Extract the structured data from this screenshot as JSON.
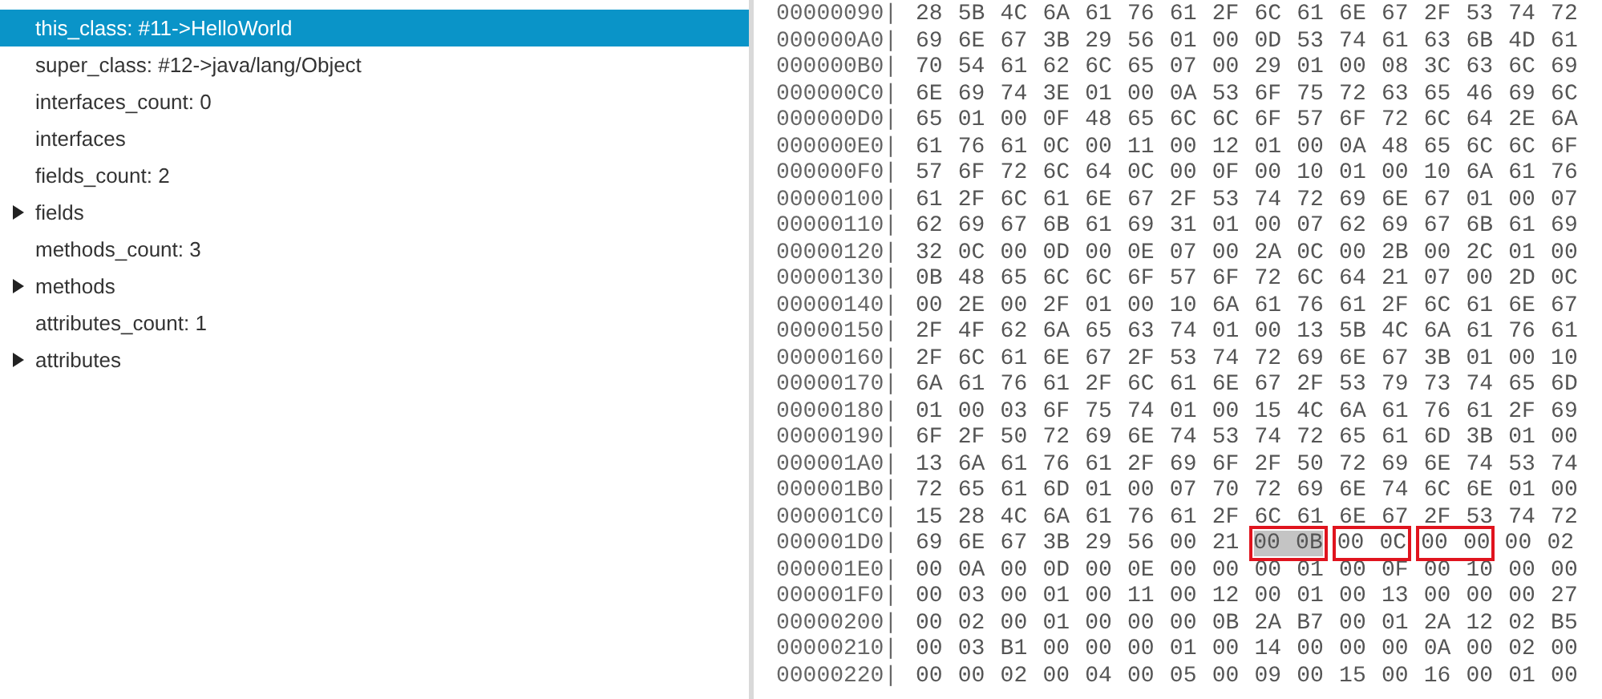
{
  "tree": {
    "items": [
      {
        "label": "this_class: #11->HelloWorld",
        "kind": "leaf",
        "selected": true
      },
      {
        "label": "super_class: #12->java/lang/Object",
        "kind": "leaf",
        "selected": false
      },
      {
        "label": "interfaces_count: 0",
        "kind": "leaf",
        "selected": false
      },
      {
        "label": "interfaces",
        "kind": "leaf",
        "selected": false
      },
      {
        "label": "fields_count: 2",
        "kind": "leaf",
        "selected": false
      },
      {
        "label": "fields",
        "kind": "node",
        "expanded": false,
        "selected": false
      },
      {
        "label": "methods_count: 3",
        "kind": "leaf",
        "selected": false
      },
      {
        "label": "methods",
        "kind": "node",
        "expanded": false,
        "selected": false
      },
      {
        "label": "attributes_count: 1",
        "kind": "leaf",
        "selected": false
      },
      {
        "label": "attributes",
        "kind": "node",
        "expanded": false,
        "selected": false
      }
    ]
  },
  "hex": {
    "rows": [
      {
        "offset": "00000090|",
        "segments": [
          {
            "text": "28 5B 4C 6A 61 76 61 2F 6C 61 6E 67 2F 53 74 72",
            "boxed": false,
            "selected": false
          }
        ]
      },
      {
        "offset": "000000A0|",
        "segments": [
          {
            "text": "69 6E 67 3B 29 56 01 00 0D 53 74 61 63 6B 4D 61",
            "boxed": false,
            "selected": false
          }
        ]
      },
      {
        "offset": "000000B0|",
        "segments": [
          {
            "text": "70 54 61 62 6C 65 07 00 29 01 00 08 3C 63 6C 69",
            "boxed": false,
            "selected": false
          }
        ]
      },
      {
        "offset": "000000C0|",
        "segments": [
          {
            "text": "6E 69 74 3E 01 00 0A 53 6F 75 72 63 65 46 69 6C",
            "boxed": false,
            "selected": false
          }
        ]
      },
      {
        "offset": "000000D0|",
        "segments": [
          {
            "text": "65 01 00 0F 48 65 6C 6C 6F 57 6F 72 6C 64 2E 6A",
            "boxed": false,
            "selected": false
          }
        ]
      },
      {
        "offset": "000000E0|",
        "segments": [
          {
            "text": "61 76 61 0C 00 11 00 12 01 00 0A 48 65 6C 6C 6F",
            "boxed": false,
            "selected": false
          }
        ]
      },
      {
        "offset": "000000F0|",
        "segments": [
          {
            "text": "57 6F 72 6C 64 0C 00 0F 00 10 01 00 10 6A 61 76",
            "boxed": false,
            "selected": false
          }
        ]
      },
      {
        "offset": "00000100|",
        "segments": [
          {
            "text": "61 2F 6C 61 6E 67 2F 53 74 72 69 6E 67 01 00 07",
            "boxed": false,
            "selected": false
          }
        ]
      },
      {
        "offset": "00000110|",
        "segments": [
          {
            "text": "62 69 67 6B 61 69 31 01 00 07 62 69 67 6B 61 69",
            "boxed": false,
            "selected": false
          }
        ]
      },
      {
        "offset": "00000120|",
        "segments": [
          {
            "text": "32 0C 00 0D 00 0E 07 00 2A 0C 00 2B 00 2C 01 00",
            "boxed": false,
            "selected": false
          }
        ]
      },
      {
        "offset": "00000130|",
        "segments": [
          {
            "text": "0B 48 65 6C 6C 6F 57 6F 72 6C 64 21 07 00 2D 0C",
            "boxed": false,
            "selected": false
          }
        ]
      },
      {
        "offset": "00000140|",
        "segments": [
          {
            "text": "00 2E 00 2F 01 00 10 6A 61 76 61 2F 6C 61 6E 67",
            "boxed": false,
            "selected": false
          }
        ]
      },
      {
        "offset": "00000150|",
        "segments": [
          {
            "text": "2F 4F 62 6A 65 63 74 01 00 13 5B 4C 6A 61 76 61",
            "boxed": false,
            "selected": false
          }
        ]
      },
      {
        "offset": "00000160|",
        "segments": [
          {
            "text": "2F 6C 61 6E 67 2F 53 74 72 69 6E 67 3B 01 00 10",
            "boxed": false,
            "selected": false
          }
        ]
      },
      {
        "offset": "00000170|",
        "segments": [
          {
            "text": "6A 61 76 61 2F 6C 61 6E 67 2F 53 79 73 74 65 6D",
            "boxed": false,
            "selected": false
          }
        ]
      },
      {
        "offset": "00000180|",
        "segments": [
          {
            "text": "01 00 03 6F 75 74 01 00 15 4C 6A 61 76 61 2F 69",
            "boxed": false,
            "selected": false
          }
        ]
      },
      {
        "offset": "00000190|",
        "segments": [
          {
            "text": "6F 2F 50 72 69 6E 74 53 74 72 65 61 6D 3B 01 00",
            "boxed": false,
            "selected": false
          }
        ]
      },
      {
        "offset": "000001A0|",
        "segments": [
          {
            "text": "13 6A 61 76 61 2F 69 6F 2F 50 72 69 6E 74 53 74",
            "boxed": false,
            "selected": false
          }
        ]
      },
      {
        "offset": "000001B0|",
        "segments": [
          {
            "text": "72 65 61 6D 01 00 07 70 72 69 6E 74 6C 6E 01 00",
            "boxed": false,
            "selected": false
          }
        ]
      },
      {
        "offset": "000001C0|",
        "segments": [
          {
            "text": "15 28 4C 6A 61 76 61 2F 6C 61 6E 67 2F 53 74 72",
            "boxed": false,
            "selected": false
          }
        ]
      },
      {
        "offset": "000001D0|",
        "segments": [
          {
            "text": "69 6E 67 3B 29 56 00 21",
            "boxed": false,
            "selected": false
          },
          {
            "text": "00 0B",
            "boxed": true,
            "selected": true
          },
          {
            "text": "00 0C",
            "boxed": true,
            "selected": false
          },
          {
            "text": "00 00",
            "boxed": true,
            "selected": false
          },
          {
            "text": "00 02",
            "boxed": false,
            "selected": false
          }
        ]
      },
      {
        "offset": "000001E0|",
        "segments": [
          {
            "text": "00 0A 00 0D 00 0E 00 00 00 01 00 0F 00 10 00 00",
            "boxed": false,
            "selected": false
          }
        ]
      },
      {
        "offset": "000001F0|",
        "segments": [
          {
            "text": "00 03 00 01 00 11 00 12 00 01 00 13 00 00 00 27",
            "boxed": false,
            "selected": false
          }
        ]
      },
      {
        "offset": "00000200|",
        "segments": [
          {
            "text": "00 02 00 01 00 00 00 0B 2A B7 00 01 2A 12 02 B5",
            "boxed": false,
            "selected": false
          }
        ]
      },
      {
        "offset": "00000210|",
        "segments": [
          {
            "text": "00 03 B1 00 00 00 01 00 14 00 00 00 0A 00 02 00",
            "boxed": false,
            "selected": false
          }
        ]
      },
      {
        "offset": "00000220|",
        "segments": [
          {
            "text": "00 00 02 00 04 00 05 00 09 00 15 00 16 00 01 00",
            "boxed": false,
            "selected": false
          }
        ]
      }
    ]
  }
}
